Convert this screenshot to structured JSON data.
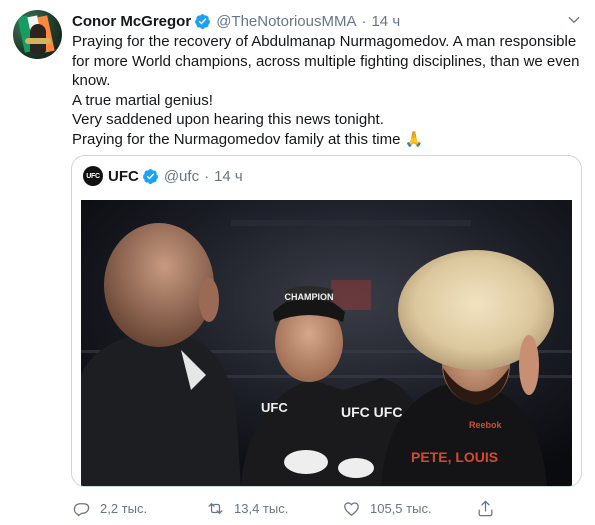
{
  "author": {
    "name": "Conor McGregor",
    "handle": "@TheNotoriousMMA",
    "time": "14 ч"
  },
  "tweet_lines": [
    "Praying for the recovery of Abdulmanap Nurmagomedov. A man responsible",
    "for more World champions, across multiple fighting disciplines, than we even",
    "know.",
    "A true martial genius!",
    "Very saddened upon hearing this news tonight.",
    "Praying for the Nurmagomedov family at this time 🙏"
  ],
  "quoted": {
    "avatar_text": "UFC",
    "name": "UFC",
    "handle": "@ufc",
    "time": "14 ч",
    "photo": {
      "cap_text": "CHAMPION",
      "shirt_text_left": "UFC",
      "shirt_text_right": "UFC UFC",
      "shirt_text_red": "PETE, LOUIS",
      "brand_text": "Reebok"
    }
  },
  "actions": {
    "reply_count": "2,2 тыс.",
    "retweet_count": "13,4 тыс.",
    "like_count": "105,5 тыс."
  },
  "colors": {
    "verified": "#1da1f2",
    "secondary": "#657786",
    "border": "#ccd6dd"
  }
}
